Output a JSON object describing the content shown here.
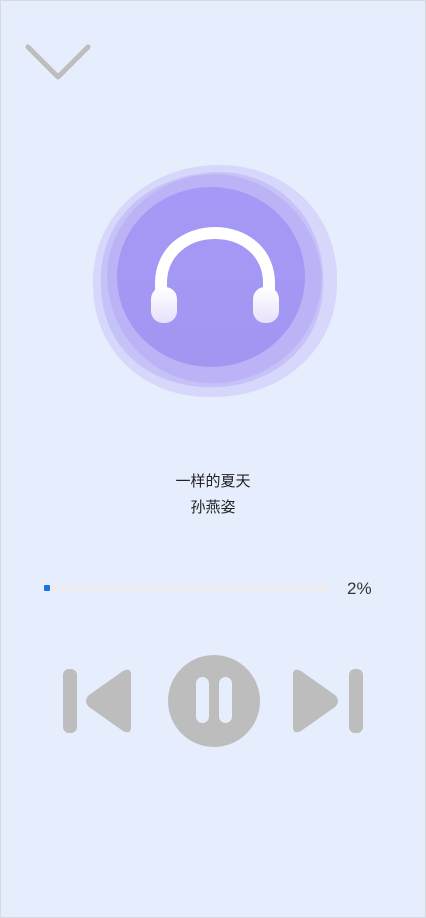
{
  "player": {
    "collapse_icon": "chevron-down-icon",
    "art_icon": "headphones-icon",
    "song_title": "一样的夏天",
    "artist": "孙燕姿",
    "progress_percent": 2,
    "progress_label": "2%",
    "controls": {
      "prev_icon": "skip-previous-icon",
      "pause_icon": "pause-icon",
      "next_icon": "skip-next-icon"
    },
    "colors": {
      "background": "#e6edfd",
      "accent": "#1473e6",
      "control_gray": "#bdbdbd",
      "art_purple": "#a99cf4"
    }
  }
}
